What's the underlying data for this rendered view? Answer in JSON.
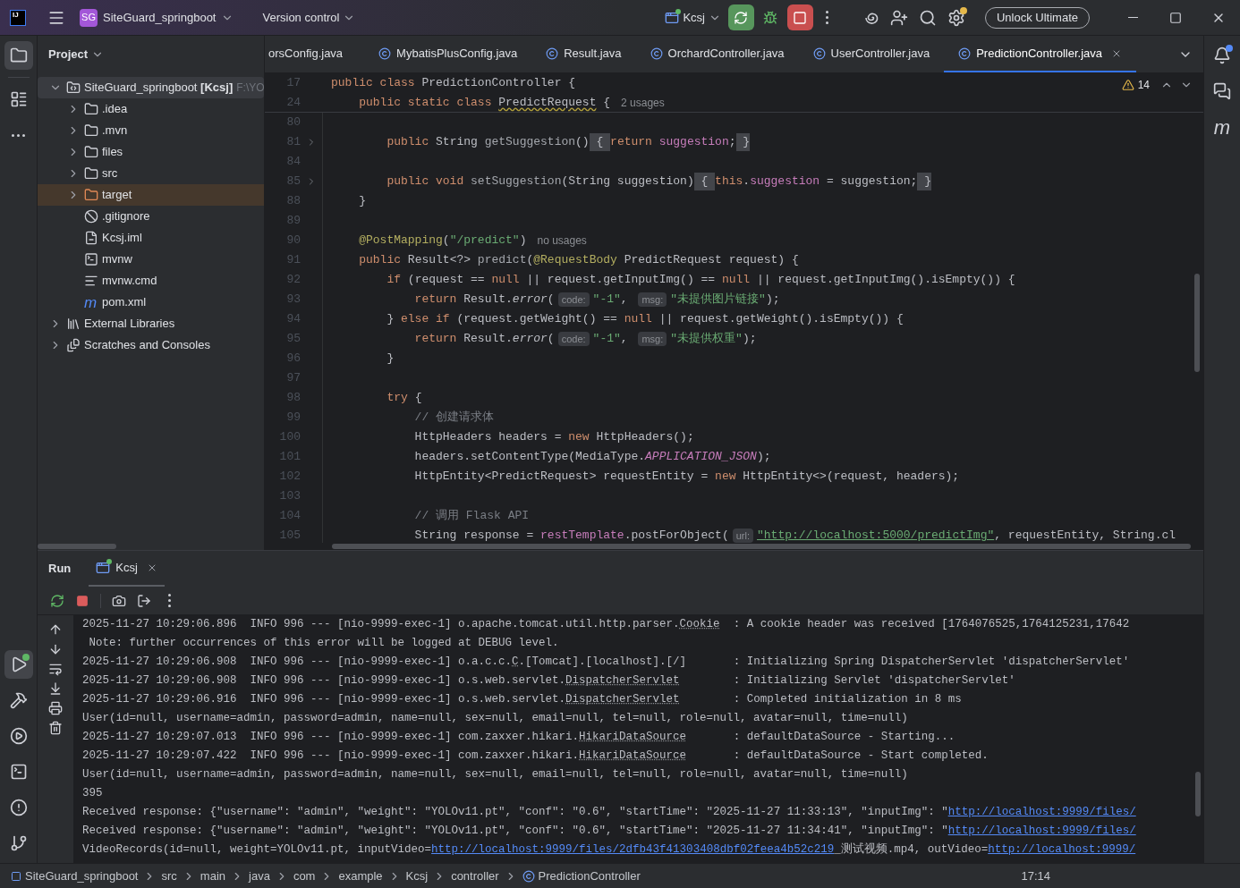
{
  "title_bar": {
    "logo": "IJ",
    "project_badge": "SG",
    "project": "SiteGuard_springboot",
    "vcs": "Version control",
    "run_config": "Kcsj",
    "upgrade_button": "Unlock Ultimate"
  },
  "project_panel": {
    "title": "Project",
    "tree": [
      {
        "label": "SiteGuard_springboot **[Kcsj]**",
        "path": "F:\\YO",
        "kind": "module",
        "selected": true,
        "expanded": true,
        "children": [
          {
            "label": ".idea",
            "kind": "folder",
            "selected": false,
            "expanded": false
          },
          {
            "label": ".mvn",
            "kind": "folder",
            "selected": false,
            "expanded": false
          },
          {
            "label": "files",
            "kind": "folder",
            "selected": false,
            "expanded": false
          },
          {
            "label": "src",
            "kind": "folder",
            "selected": false,
            "expanded": false
          },
          {
            "label": "target",
            "kind": "excluded_folder",
            "selected": false,
            "expanded": false
          },
          {
            "label": ".gitignore",
            "kind": "ignore",
            "selected": false
          },
          {
            "label": "Kcsj.iml",
            "kind": "iml",
            "selected": false
          },
          {
            "label": "mvnw",
            "kind": "script",
            "selected": false
          },
          {
            "label": "mvnw.cmd",
            "kind": "text",
            "selected": false
          },
          {
            "label": "pom.xml",
            "kind": "maven",
            "icon_glyph": "m",
            "selected": false
          }
        ]
      },
      {
        "label": "External Libraries",
        "kind": "libraries",
        "selected": false,
        "expanded": false
      },
      {
        "label": "Scratches and Consoles",
        "kind": "scratches",
        "selected": false,
        "expanded": false
      }
    ]
  },
  "editor": {
    "tabs": [
      {
        "label": "orsConfig.java",
        "icon": false,
        "selected": false
      },
      {
        "label": "MybatisPlusConfig.java",
        "icon": true,
        "selected": false
      },
      {
        "label": "Result.java",
        "icon": true,
        "selected": false
      },
      {
        "label": "OrchardController.java",
        "icon": true,
        "selected": false
      },
      {
        "label": "UserController.java",
        "icon": true,
        "selected": false
      },
      {
        "label": "PredictionController.java",
        "icon": true,
        "selected": true
      }
    ],
    "warnings": "14",
    "sticky_lines": [
      {
        "number": "17",
        "tokens": [
          {
            "kind": "kw",
            "text": "public class "
          },
          {
            "kind": "plain",
            "text": "PredictionController {"
          }
        ]
      },
      {
        "number": "24",
        "tokens": [
          {
            "kind": "kw",
            "text": "    public static class "
          },
          {
            "kind": "warn",
            "text": "PredictRequest"
          },
          {
            "kind": "plain",
            "text": " {"
          },
          {
            "kind": "usage",
            "text": "2 usages"
          }
        ]
      }
    ],
    "lines": [
      {
        "number": "80",
        "folded": false
      },
      {
        "number": "81",
        "folded": true,
        "tokens": [
          {
            "kind": "kw",
            "text": "        public "
          },
          {
            "kind": "plain",
            "text": "String "
          },
          {
            "kind": "decl",
            "text": "getSuggestion"
          },
          {
            "kind": "plain",
            "text": "()"
          },
          {
            "kind": "fold",
            "text": " { "
          },
          {
            "kind": "kw",
            "text": "return "
          },
          {
            "kind": "field",
            "text": "suggestion"
          },
          {
            "kind": "plain",
            "text": ";"
          },
          {
            "kind": "fold",
            "text": " }"
          }
        ]
      },
      {
        "number": "84",
        "folded": false
      },
      {
        "number": "85",
        "folded": true,
        "tokens": [
          {
            "kind": "kw",
            "text": "        public void "
          },
          {
            "kind": "decl",
            "text": "setSuggestion"
          },
          {
            "kind": "plain",
            "text": "(String suggestion)"
          },
          {
            "kind": "fold",
            "text": " { "
          },
          {
            "kind": "kw",
            "text": "this"
          },
          {
            "kind": "plain",
            "text": "."
          },
          {
            "kind": "field",
            "text": "suggestion"
          },
          {
            "kind": "plain",
            "text": " = suggestion;"
          },
          {
            "kind": "fold",
            "text": " }"
          }
        ]
      },
      {
        "number": "88",
        "folded": false,
        "tokens": [
          {
            "kind": "plain",
            "text": "    }"
          }
        ]
      },
      {
        "number": "89",
        "folded": false
      },
      {
        "number": "90",
        "folded": false,
        "tokens": [
          {
            "kind": "ann",
            "text": "    @PostMapping"
          },
          {
            "kind": "plain",
            "text": "("
          },
          {
            "kind": "str",
            "text": "\"/predict\""
          },
          {
            "kind": "plain",
            "text": ")"
          },
          {
            "kind": "usage",
            "text": "no usages"
          }
        ]
      },
      {
        "number": "91",
        "folded": false,
        "tokens": [
          {
            "kind": "kw",
            "text": "    public "
          },
          {
            "kind": "plain",
            "text": "Result<?> "
          },
          {
            "kind": "decl",
            "text": "predict"
          },
          {
            "kind": "plain",
            "text": "("
          },
          {
            "kind": "ann",
            "text": "@RequestBody "
          },
          {
            "kind": "plain",
            "text": "PredictRequest request) {"
          }
        ]
      },
      {
        "number": "92",
        "folded": false,
        "tokens": [
          {
            "kind": "kw",
            "text": "        if "
          },
          {
            "kind": "plain",
            "text": "(request == "
          },
          {
            "kind": "kw",
            "text": "null "
          },
          {
            "kind": "plain",
            "text": "|| request.getInputImg() == "
          },
          {
            "kind": "kw",
            "text": "null "
          },
          {
            "kind": "plain",
            "text": "|| request.getInputImg().isEmpty()) {"
          }
        ]
      },
      {
        "number": "93",
        "folded": false,
        "tokens": [
          {
            "kind": "kw",
            "text": "            return "
          },
          {
            "kind": "plain",
            "text": "Result."
          },
          {
            "kind": "italic",
            "text": "error"
          },
          {
            "kind": "plain",
            "text": "("
          },
          {
            "kind": "hint",
            "text": "code:"
          },
          {
            "kind": "str",
            "text": "\"-1\""
          },
          {
            "kind": "plain",
            "text": ", "
          },
          {
            "kind": "hint",
            "text": "msg:"
          },
          {
            "kind": "str",
            "text": "\"未提供图片链接\""
          },
          {
            "kind": "plain",
            "text": ");"
          }
        ]
      },
      {
        "number": "94",
        "folded": false,
        "tokens": [
          {
            "kind": "plain",
            "text": "        } "
          },
          {
            "kind": "kw",
            "text": "else if "
          },
          {
            "kind": "plain",
            "text": "(request.getWeight() == "
          },
          {
            "kind": "kw",
            "text": "null "
          },
          {
            "kind": "plain",
            "text": "|| request.getWeight().isEmpty()) {"
          }
        ]
      },
      {
        "number": "95",
        "folded": false,
        "tokens": [
          {
            "kind": "kw",
            "text": "            return "
          },
          {
            "kind": "plain",
            "text": "Result."
          },
          {
            "kind": "italic",
            "text": "error"
          },
          {
            "kind": "plain",
            "text": "("
          },
          {
            "kind": "hint",
            "text": "code:"
          },
          {
            "kind": "str",
            "text": "\"-1\""
          },
          {
            "kind": "plain",
            "text": ", "
          },
          {
            "kind": "hint",
            "text": "msg:"
          },
          {
            "kind": "str",
            "text": "\"未提供权重\""
          },
          {
            "kind": "plain",
            "text": ");"
          }
        ]
      },
      {
        "number": "96",
        "folded": false,
        "tokens": [
          {
            "kind": "plain",
            "text": "        }"
          }
        ]
      },
      {
        "number": "97",
        "folded": false
      },
      {
        "number": "98",
        "folded": false,
        "tokens": [
          {
            "kind": "kw",
            "text": "        try "
          },
          {
            "kind": "plain",
            "text": "{"
          }
        ]
      },
      {
        "number": "99",
        "folded": false,
        "tokens": [
          {
            "kind": "comment",
            "text": "            // 创建请求体"
          }
        ]
      },
      {
        "number": "100",
        "folded": false,
        "tokens": [
          {
            "kind": "plain",
            "text": "            HttpHeaders headers = "
          },
          {
            "kind": "kw",
            "text": "new "
          },
          {
            "kind": "plain",
            "text": "HttpHeaders();"
          }
        ]
      },
      {
        "number": "101",
        "folded": false,
        "tokens": [
          {
            "kind": "plain",
            "text": "            headers.setContentType(MediaType."
          },
          {
            "kind": "const",
            "text": "APPLICATION_JSON"
          },
          {
            "kind": "plain",
            "text": ");"
          }
        ]
      },
      {
        "number": "102",
        "folded": false,
        "tokens": [
          {
            "kind": "plain",
            "text": "            HttpEntity<PredictRequest> requestEntity = "
          },
          {
            "kind": "kw",
            "text": "new "
          },
          {
            "kind": "plain",
            "text": "HttpEntity<>(request, headers);"
          }
        ]
      },
      {
        "number": "103",
        "folded": false
      },
      {
        "number": "104",
        "folded": false,
        "tokens": [
          {
            "kind": "comment",
            "text": "            // 调用 Flask API"
          }
        ]
      },
      {
        "number": "105",
        "folded": false,
        "tokens": [
          {
            "kind": "plain",
            "text": "            String response = "
          },
          {
            "kind": "field",
            "text": "restTemplate"
          },
          {
            "kind": "plain",
            "text": ".postForObject("
          },
          {
            "kind": "hint",
            "text": "url:"
          },
          {
            "kind": "link",
            "text": "\"http://localhost:5000/predictImg\""
          },
          {
            "kind": "plain",
            "text": ", requestEntity, String.cl"
          }
        ]
      }
    ]
  },
  "right_strip": {
    "maven_glyph": "m"
  },
  "run_panel": {
    "title": "Run",
    "tabs": [
      {
        "label": "Kcsj",
        "selected": true
      }
    ],
    "console": [
      [
        {
          "kind": "plain",
          "text": "2025-11-27 10:29:06.896  INFO 996 --- [nio-9999-exec-1] o.apache.tomcat.util.http.parser."
        },
        {
          "kind": "ref",
          "text": "Cookie"
        },
        {
          "kind": "plain",
          "text": "  : A cookie header was received [1764076525,1764125231,17642"
        }
      ],
      [
        {
          "kind": "plain",
          "text": " Note: further occurrences of this error will be logged at DEBUG level."
        }
      ],
      [
        {
          "kind": "plain",
          "text": "2025-11-27 10:29:06.908  INFO 996 --- [nio-9999-exec-1] o.a.c.c."
        },
        {
          "kind": "ref",
          "text": "C"
        },
        {
          "kind": "plain",
          "text": ".[Tomcat].[localhost].[/]       : Initializing Spring DispatcherServlet 'dispatcherServlet'"
        }
      ],
      [
        {
          "kind": "plain",
          "text": "2025-11-27 10:29:06.908  INFO 996 --- [nio-9999-exec-1] o.s.web.servlet."
        },
        {
          "kind": "ref",
          "text": "DispatcherServlet"
        },
        {
          "kind": "plain",
          "text": "        : Initializing Servlet 'dispatcherServlet'"
        }
      ],
      [
        {
          "kind": "plain",
          "text": "2025-11-27 10:29:06.916  INFO 996 --- [nio-9999-exec-1] o.s.web.servlet."
        },
        {
          "kind": "ref",
          "text": "DispatcherServlet"
        },
        {
          "kind": "plain",
          "text": "        : Completed initialization in 8 ms"
        }
      ],
      [
        {
          "kind": "plain",
          "text": "User(id=null, username=admin, password=admin, name=null, sex=null, email=null, tel=null, role=null, avatar=null, time=null)"
        }
      ],
      [
        {
          "kind": "plain",
          "text": "2025-11-27 10:29:07.013  INFO 996 --- [nio-9999-exec-1] com.zaxxer.hikari."
        },
        {
          "kind": "ref",
          "text": "HikariDataSource"
        },
        {
          "kind": "plain",
          "text": "       : defaultDataSource - Starting..."
        }
      ],
      [
        {
          "kind": "plain",
          "text": "2025-11-27 10:29:07.422  INFO 996 --- [nio-9999-exec-1] com.zaxxer.hikari."
        },
        {
          "kind": "ref",
          "text": "HikariDataSource"
        },
        {
          "kind": "plain",
          "text": "       : defaultDataSource - Start completed."
        }
      ],
      [
        {
          "kind": "plain",
          "text": "User(id=null, username=admin, password=admin, name=null, sex=null, email=null, tel=null, role=null, avatar=null, time=null)"
        }
      ],
      [
        {
          "kind": "plain",
          "text": "395"
        }
      ],
      [
        {
          "kind": "plain",
          "text": "Received response: {\"username\": \"admin\", \"weight\": \"YOLOv11.pt\", \"conf\": \"0.6\", \"startTime\": \"2025-11-27 11:33:13\", \"inputImg\": \""
        },
        {
          "kind": "link",
          "text": "http://localhost:9999/files/"
        }
      ],
      [
        {
          "kind": "plain",
          "text": "Received response: {\"username\": \"admin\", \"weight\": \"YOLOv11.pt\", \"conf\": \"0.6\", \"startTime\": \"2025-11-27 11:34:41\", \"inputImg\": \""
        },
        {
          "kind": "link",
          "text": "http://localhost:9999/files/"
        }
      ],
      [
        {
          "kind": "plain",
          "text": "VideoRecords(id=null, weight=YOLOv11.pt, inputVideo="
        },
        {
          "kind": "link",
          "text": "http://localhost:9999/files/2dfb43f41303408dbf02feea4b52c219"
        },
        {
          "kind": "plain",
          "text": "_测试视频.mp4, outVideo="
        },
        {
          "kind": "link",
          "text": "http://localhost:9999/"
        }
      ]
    ]
  },
  "status_bar": {
    "breadcrumbs": [
      {
        "label": "SiteGuard_springboot",
        "kind": "module"
      },
      {
        "label": "src",
        "kind": "plain"
      },
      {
        "label": "main",
        "kind": "plain"
      },
      {
        "label": "java",
        "kind": "plain"
      },
      {
        "label": "com",
        "kind": "plain"
      },
      {
        "label": "example",
        "kind": "plain"
      },
      {
        "label": "Kcsj",
        "kind": "plain"
      },
      {
        "label": "controller",
        "kind": "plain"
      },
      {
        "label": "PredictionController",
        "kind": "class"
      }
    ],
    "position": "17:14"
  }
}
